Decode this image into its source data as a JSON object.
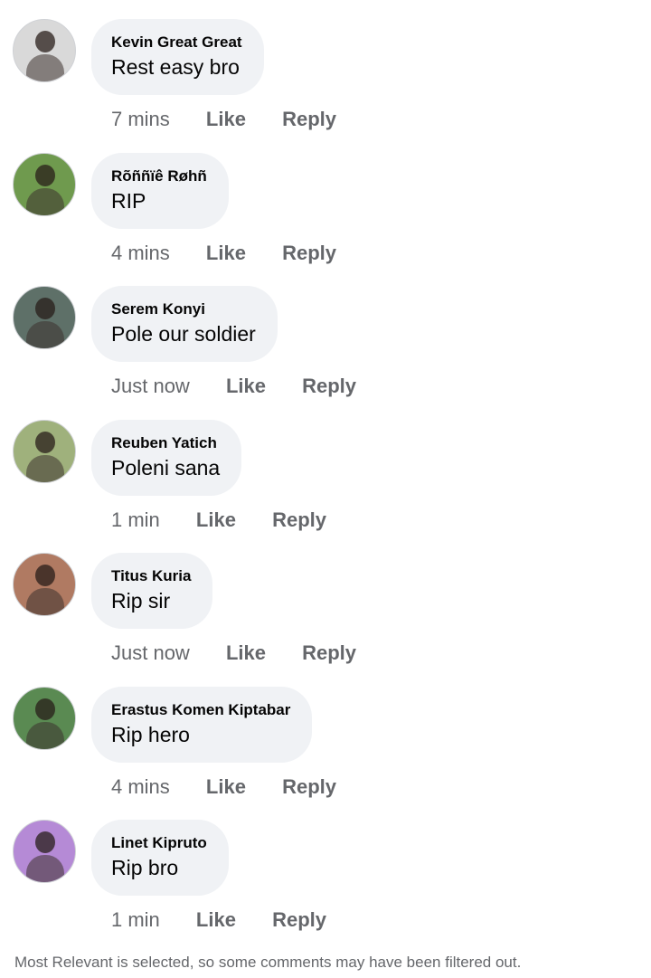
{
  "comments": [
    {
      "author": "Kevin Great Great",
      "text": "Rest easy bro",
      "time": "7 mins",
      "like": "Like",
      "reply": "Reply",
      "avatar_color": "#d9d9d9"
    },
    {
      "author": "Rõññïê Røhñ",
      "text": "RIP",
      "time": "4 mins",
      "like": "Like",
      "reply": "Reply",
      "avatar_color": "#6f9a4e"
    },
    {
      "author": "Serem Konyi",
      "text": "Pole our soldier",
      "time": "Just now",
      "like": "Like",
      "reply": "Reply",
      "avatar_color": "#5e7068"
    },
    {
      "author": "Reuben Yatich",
      "text": "Poleni sana",
      "time": "1 min",
      "like": "Like",
      "reply": "Reply",
      "avatar_color": "#9fb17c"
    },
    {
      "author": "Titus Kuria",
      "text": "Rip sir",
      "time": "Just now",
      "like": "Like",
      "reply": "Reply",
      "avatar_color": "#b07a62"
    },
    {
      "author": "Erastus Komen Kiptabar",
      "text": "Rip hero",
      "time": "4 mins",
      "like": "Like",
      "reply": "Reply",
      "avatar_color": "#5a8a52"
    },
    {
      "author": "Linet Kipruto",
      "text": "Rip bro",
      "time": "1 min",
      "like": "Like",
      "reply": "Reply",
      "avatar_color": "#b58ad6"
    }
  ],
  "footer_note": "Most Relevant is selected, so some comments may have been filtered out."
}
